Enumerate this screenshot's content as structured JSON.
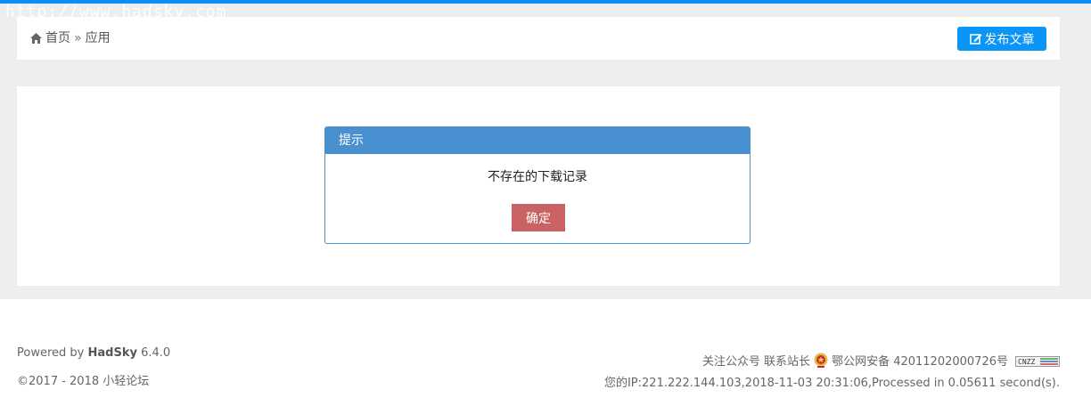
{
  "watermark": "http://www.hadsky.com",
  "breadcrumb": {
    "home_label": "首页",
    "separator": "»",
    "current": "应用"
  },
  "toolbar": {
    "publish_label": "发布文章"
  },
  "dialog": {
    "title": "提示",
    "message": "不存在的下载记录",
    "confirm_label": "确定"
  },
  "footer": {
    "powered_prefix": "Powered by",
    "brand": "HadSky",
    "version": "6.4.0",
    "copyright": "©2017 - 2018 小轻论坛",
    "follow_label": "关注公众号",
    "contact_label": "联系站长",
    "icp": "鄂公网安备 42011202000726号",
    "cnzz": "CNZZ",
    "status_line": "您的IP:221.222.144.103,2018-11-03 20:31:06,Processed in 0.05611 second(s)."
  },
  "colors": {
    "accent": "#0a95f7",
    "dialog_header": "#4990d0",
    "confirm": "#c96363",
    "background": "#eeeeee"
  }
}
